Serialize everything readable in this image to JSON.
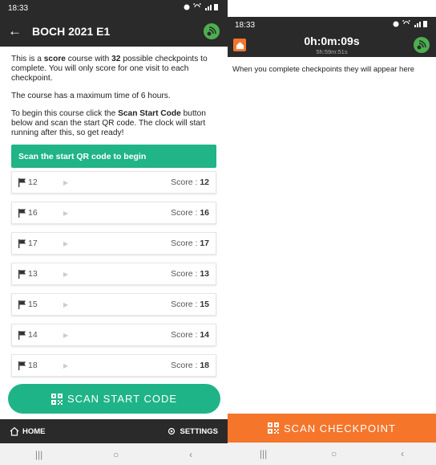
{
  "left": {
    "status": {
      "time": "18:33"
    },
    "appbar": {
      "title": "BOCH 2021 E1"
    },
    "intro": {
      "p1_a": "This is a ",
      "p1_b": "score",
      "p1_c": " course with ",
      "p1_d": "32",
      "p1_e": " possible checkpoints to complete. You will only score for one visit to each checkpoint.",
      "p2": "The course has a maximum time of 6 hours.",
      "p3_a": "To begin this course click the ",
      "p3_b": "Scan Start Code",
      "p3_c": " button below and scan the start QR code. The clock will start running after this, so get ready!"
    },
    "banner": "Scan the start QR code to begin",
    "score_label": "Score : ",
    "checkpoints": [
      {
        "num": "12",
        "score": "12"
      },
      {
        "num": "16",
        "score": "16"
      },
      {
        "num": "17",
        "score": "17"
      },
      {
        "num": "13",
        "score": "13"
      },
      {
        "num": "15",
        "score": "15"
      },
      {
        "num": "14",
        "score": "14"
      },
      {
        "num": "18",
        "score": "18"
      }
    ],
    "scan_button": "SCAN START CODE",
    "bottom": {
      "home": "HOME",
      "settings": "SETTINGS"
    },
    "colors": {
      "accent": "#1fb487",
      "bar": "#2a2a2a"
    }
  },
  "right": {
    "status": {
      "time": "18:33"
    },
    "timer": "0h:0m:09s",
    "remaining": "5h:59m:51s",
    "message": "When you complete checkpoints they will appear here",
    "scan_button": "SCAN CHECKPOINT",
    "colors": {
      "accent": "#f5752b"
    }
  }
}
